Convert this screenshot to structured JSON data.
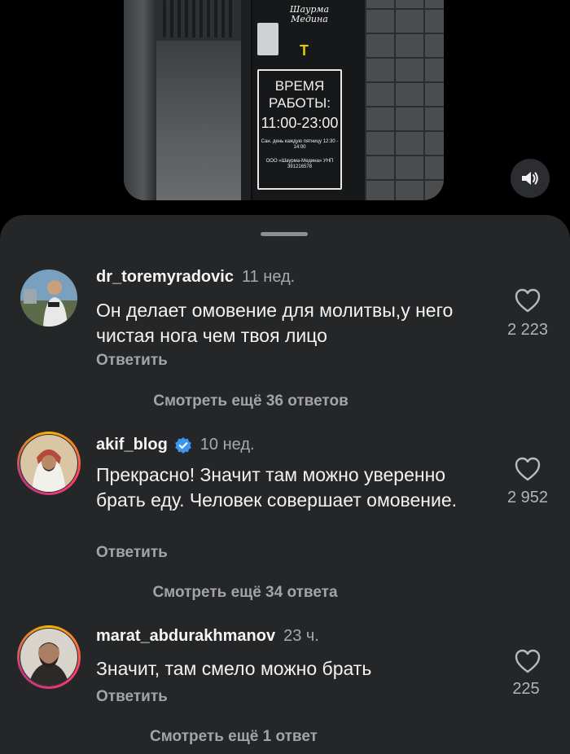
{
  "video": {
    "sign": {
      "logo_text": "Шаурма Медина",
      "hours_title": "ВРЕМЯ РАБОТЫ:",
      "hours_time": "11:00-23:00",
      "sanitary_note": "Сан. день каждую пятницу 12:30 - 14:00",
      "org": "ООО «Шаурма-Медина» УНП 391216578"
    },
    "mute_icon": "speaker-muted-icon"
  },
  "comments": [
    {
      "username": "dr_toremyradovic",
      "time": "11 нед.",
      "text": "Он делает омовение для молитвы,у него чистая нога чем твоя лицо",
      "reply_label": "Ответить",
      "likes": "2 223",
      "verified": false,
      "view_more": "Смотреть ещё 36 ответов"
    },
    {
      "username": "akif_blog",
      "time": "10 нед.",
      "text": "Прекрасно! Значит там можно уверенно брать еду. Человек совершает омовение.",
      "reply_label": "Ответить",
      "likes": "2 952",
      "verified": true,
      "view_more": "Смотреть ещё 34 ответа"
    },
    {
      "username": "marat_abdurakhmanov",
      "time": "23 ч.",
      "text": "Значит, там смело можно брать",
      "reply_label": "Ответить",
      "likes": "225",
      "verified": false,
      "view_more": "Смотреть ещё 1 ответ"
    }
  ],
  "colors": {
    "sheet_bg": "#252628",
    "verified_blue": "#3897f0",
    "secondary_text": "#a2a4a6"
  }
}
